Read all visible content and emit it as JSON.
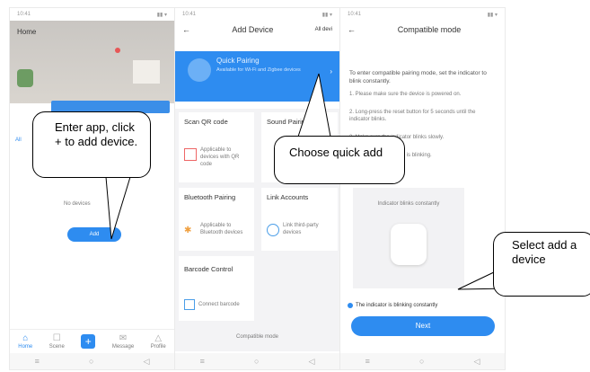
{
  "screen1": {
    "home_label": "Home",
    "empty_text": "No devices",
    "add_button": "Add",
    "tabs": [
      "Home",
      "Scene",
      "",
      "Message",
      "Profile"
    ]
  },
  "screen2": {
    "back": "←",
    "title": "Add Device",
    "all_devices": "All devi",
    "banner_title": "Quick Pairing",
    "banner_desc": "Available for Wi-Fi and Zigbee devices",
    "options": [
      {
        "title": "Scan QR code",
        "desc": "Applicable to devices with QR code"
      },
      {
        "title": "Sound Pairing",
        "desc": ""
      },
      {
        "title": "Bluetooth Pairing",
        "desc": "Applicable to Bluetooth devices"
      },
      {
        "title": "Link Accounts",
        "desc": "Link third-party devices"
      },
      {
        "title": "Barcode Control",
        "desc": "Connect barcode"
      }
    ],
    "footer": "Compatible mode"
  },
  "screen3": {
    "back": "←",
    "title": "Compatible mode",
    "intro": "To enter compatible pairing mode, set the indicator to blink constantly.",
    "steps": [
      "1. Please make sure the device is powered on.",
      "2. Long-press the reset button for 5 seconds until the indicator blinks.",
      "3. Make sure the indicator blinks slowly.",
      "4. Confirm the indicator is blinking."
    ],
    "image_caption": "Indicator blinks constantly",
    "checkbox_label": "The indicator is blinking constantly",
    "next_button": "Next"
  },
  "callouts": {
    "c1": "Enter app, click + to add device.",
    "c2": "Choose quick add",
    "c3": "Select add a device"
  },
  "colors": {
    "accent": "#2e8cf0",
    "banner": "#2e8cf0"
  }
}
